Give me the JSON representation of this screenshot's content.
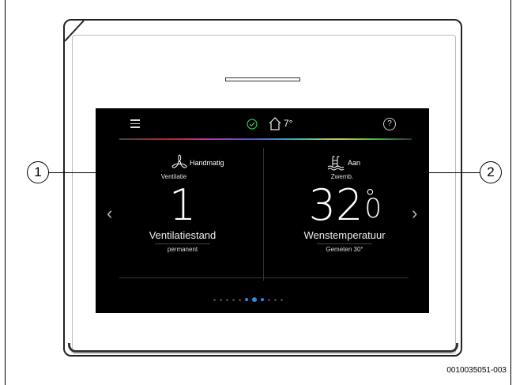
{
  "header": {
    "house_temp": "7°",
    "help_symbol": "?"
  },
  "left_panel": {
    "mode": "Handmatig",
    "title": "Ventilatie",
    "value": "1",
    "label": "Ventilatiestand",
    "sub_value": "permanent",
    "icon": "fan-icon"
  },
  "right_panel": {
    "mode": "Aan",
    "title": "Zwemb.",
    "value": "32",
    "value_unit": "°",
    "value_decimal": "0",
    "label": "Wenstemperatuur",
    "sub_value": "Gemeten 30°",
    "icon": "pool-icon"
  },
  "navigation": {
    "prev_arrow": "‹",
    "next_arrow": "›",
    "page_count": 11,
    "active_page": 7
  },
  "callouts": {
    "left": "1",
    "right": "2"
  },
  "figure_id": "0010035051-003",
  "colors": {
    "screen_bg": "#000000",
    "accent_blue": "#2a8fe0",
    "check_green": "#3fbf5a"
  }
}
